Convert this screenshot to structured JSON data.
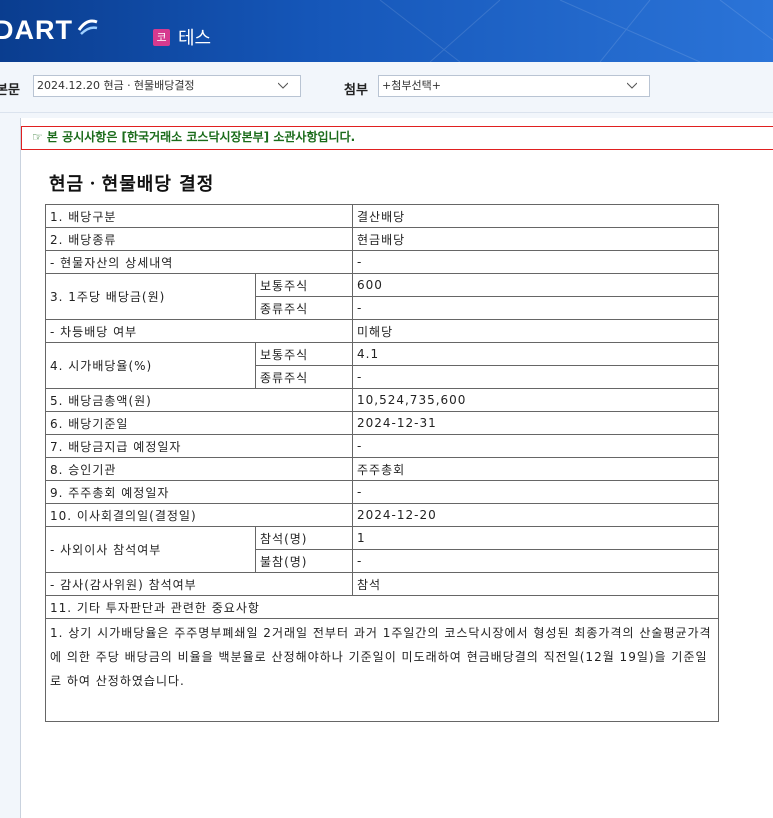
{
  "header": {
    "logo": "DART",
    "company_name": "테스",
    "market_badge": "코"
  },
  "toolbar": {
    "body_label": "본문",
    "body_select_value": "2024.12.20  현금ㆍ현물배당결정",
    "attach_label": "첨부",
    "attach_select_value": "+첨부선택+"
  },
  "notice": "☞ 본 공시사항은 [한국거래소 코스닥시장본부] 소관사항입니다.",
  "title": "현금ㆍ현물배당 결정",
  "table": {
    "r1": {
      "label": "1. 배당구분",
      "value": "결산배당"
    },
    "r2": {
      "label": "2. 배당종류",
      "value": "현금배당"
    },
    "r3": {
      "label": "- 현물자산의 상세내역",
      "value": "-"
    },
    "r4": {
      "label": "3. 1주당 배당금(원)",
      "sub1": "보통주식",
      "val1": "600",
      "sub2": "종류주식",
      "val2": "-"
    },
    "r5": {
      "label": "- 차등배당 여부",
      "value": "미해당"
    },
    "r6": {
      "label": "4. 시가배당율(%)",
      "sub1": "보통주식",
      "val1": "4.1",
      "sub2": "종류주식",
      "val2": "-"
    },
    "r7": {
      "label": "5. 배당금총액(원)",
      "value": "10,524,735,600"
    },
    "r8": {
      "label": "6. 배당기준일",
      "value": "2024-12-31"
    },
    "r9": {
      "label": "7. 배당금지급 예정일자",
      "value": "-"
    },
    "r10": {
      "label": "8. 승인기관",
      "value": "주주총회"
    },
    "r11": {
      "label": "9. 주주총회 예정일자",
      "value": "-"
    },
    "r12": {
      "label": "10. 이사회결의일(결정일)",
      "value": "2024-12-20"
    },
    "r13": {
      "label": "- 사외이사 참석여부",
      "sub1": "참석(명)",
      "val1": "1",
      "sub2": "불참(명)",
      "val2": "-"
    },
    "r14": {
      "label": "- 감사(감사위원) 참석여부",
      "value": "참석"
    },
    "r15": {
      "label": "11. 기타 투자판단과 관련한 중요사항"
    },
    "note": "1. 상기 시가배당율은 주주명부폐쇄일 2거래일 전부터 과거 1주일간의 코스닥시장에서 형성된 최종가격의 산술평균가격에 의한 주당 배당금의 비율을 백분율로 산정해야하나 기준일이 미도래하여 현금배당결의 직전일(12월 19일)을 기준일로 하여 산정하였습니다."
  }
}
